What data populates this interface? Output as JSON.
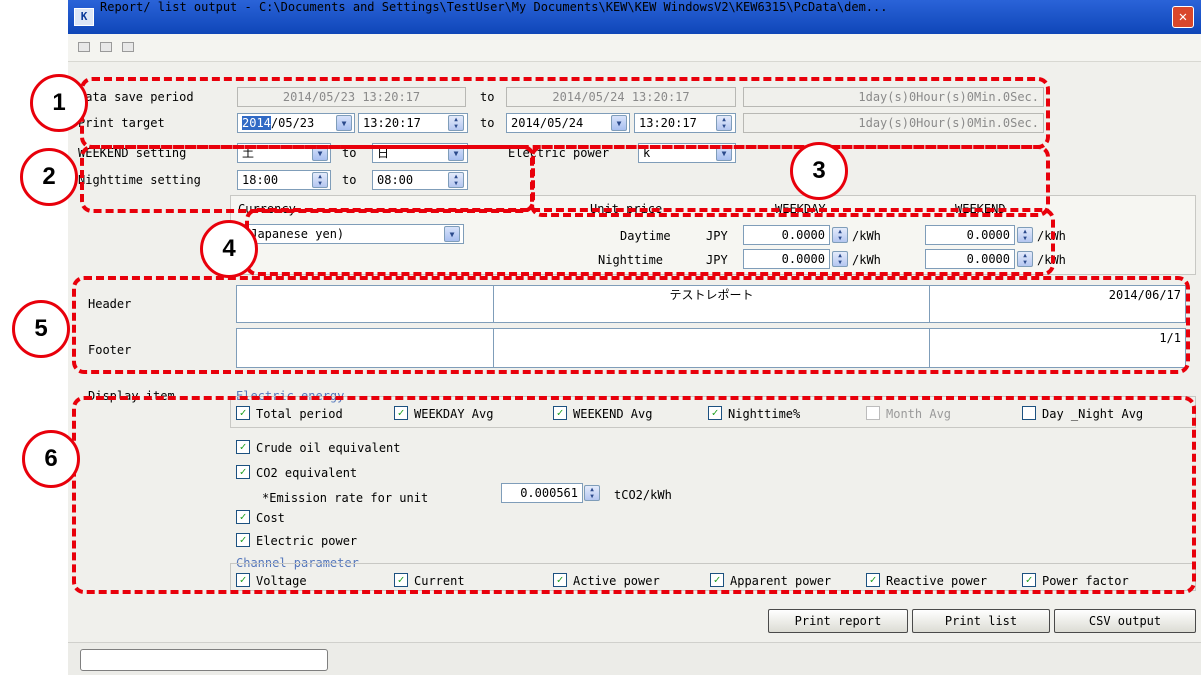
{
  "window": {
    "title": "Report/ list output - C:\\Documents and Settings\\TestUser\\My Documents\\KEW\\KEW WindowsV2\\KEW6315\\PcData\\dem...",
    "close_glyph": "✕",
    "app_icon_text": "K"
  },
  "data_save_period": {
    "label": "Data save period",
    "from": "2014/05/23 13:20:17",
    "to_label": "to",
    "to": "2014/05/24 13:20:17",
    "duration": "1day(s)0Hour(s)0Min.0Sec."
  },
  "print_target": {
    "label": "Print target",
    "from_date_sel": "2014",
    "from_date_rest": "/05/23",
    "from_time": "13:20:17",
    "to_label": "to",
    "to_date": "2014/05/24",
    "to_time": "13:20:17",
    "duration": "1day(s)0Hour(s)0Min.0Sec."
  },
  "weekend_setting": {
    "label": "WEEKEND setting",
    "from": "土",
    "to_label": "to",
    "to": "日"
  },
  "electric_power_unit": {
    "label": "Electric power",
    "value": "k"
  },
  "nighttime_setting": {
    "label": "Nighttime setting",
    "from": "18:00",
    "to_label": "to",
    "to": "08:00"
  },
  "currency_panel": {
    "currency_label": "Currency",
    "currency_value": "(Japanese yen)",
    "unit_price_label": "Unit price",
    "weekday_header": "WEEKDAY",
    "weekend_header": "WEEKEND",
    "rows": [
      {
        "label": "Daytime",
        "currency": "JPY",
        "weekday": "0.0000",
        "weekend": "0.0000",
        "unit": "/kWh"
      },
      {
        "label": "Nighttime",
        "currency": "JPY",
        "weekday": "0.0000",
        "weekend": "0.0000",
        "unit": "/kWh"
      }
    ]
  },
  "header_footer": {
    "header_label": "Header",
    "header_left": "",
    "header_center": "テストレポート",
    "header_right": "2014/06/17",
    "footer_label": "Footer",
    "footer_left": "",
    "footer_center": "",
    "footer_right": "1/1"
  },
  "display_item": {
    "label": "Display item",
    "electric_energy_group": "Electric energy",
    "energy_items": [
      {
        "label": "Total period",
        "checked": true
      },
      {
        "label": "WEEKDAY Avg",
        "checked": true
      },
      {
        "label": "WEEKEND Avg",
        "checked": true
      },
      {
        "label": "Nighttime%",
        "checked": true
      },
      {
        "label": "Month Avg",
        "checked": false,
        "disabled": true
      },
      {
        "label": "Day _Night Avg",
        "checked": false
      }
    ],
    "crude_oil": "Crude oil equivalent",
    "co2": "CO2 equivalent",
    "emission_label": "*Emission rate for unit",
    "emission_value": "0.000561",
    "emission_unit": "tCO2/kWh",
    "cost": "Cost",
    "electric_power": "Electric power",
    "channel_group": "Channel parameter",
    "channel_items": [
      {
        "label": "Voltage",
        "checked": true
      },
      {
        "label": "Current",
        "checked": true
      },
      {
        "label": "Active power",
        "checked": true
      },
      {
        "label": "Apparent power",
        "checked": true
      },
      {
        "label": "Reactive power",
        "checked": true
      },
      {
        "label": "Power factor",
        "checked": true
      }
    ]
  },
  "buttons": {
    "print_report": "Print report",
    "print_list": "Print list",
    "csv_output": "CSV output"
  },
  "status_bar": {
    "text": ""
  },
  "callouts": [
    "1",
    "2",
    "3",
    "4",
    "5",
    "6"
  ],
  "colors": {
    "titlebar": "#0f46b8",
    "callout_red": "#e8000b",
    "check_green": "#20a020",
    "group_label_blue": "#5577bb"
  }
}
